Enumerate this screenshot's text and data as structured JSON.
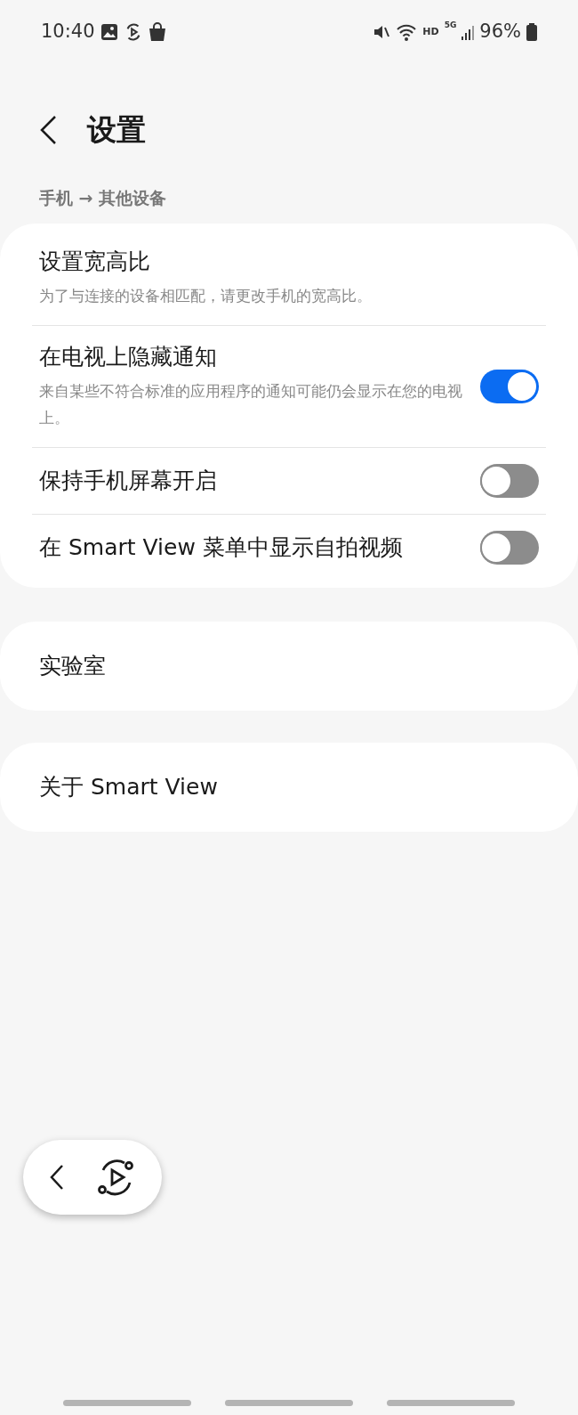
{
  "status_bar": {
    "time": "10:40",
    "battery": "96%",
    "network": "HD",
    "cellular": "5G"
  },
  "header": {
    "title": "设置"
  },
  "section_label": "手机 → 其他设备",
  "settings": [
    {
      "kind": "link",
      "title": "设置宽高比",
      "subtitle": "为了与连接的设备相匹配，请更改手机的宽高比。"
    },
    {
      "kind": "toggle",
      "title": "在电视上隐藏通知",
      "subtitle": "来自某些不符合标准的应用程序的通知可能仍会显示在您的电视上。",
      "on": true
    },
    {
      "kind": "toggle",
      "title": "保持手机屏幕开启",
      "on": false
    },
    {
      "kind": "toggle",
      "title": "在 Smart View 菜单中显示自拍视频",
      "on": false
    }
  ],
  "cards": [
    {
      "title": "实验室"
    },
    {
      "title": "关于 Smart View"
    }
  ]
}
